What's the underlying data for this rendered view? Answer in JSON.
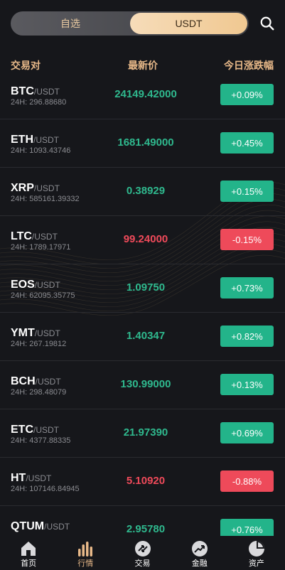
{
  "topbar": {
    "tab_fav": "自选",
    "tab_usdt": "USDT"
  },
  "header": {
    "pair": "交易对",
    "price": "最新价",
    "change": "今日涨跌幅"
  },
  "rows": [
    {
      "base": "BTC",
      "quote": "/USDT",
      "vol": "24H: 296.88680",
      "price": "24149.42000",
      "change": "+0.09%",
      "dir": "up"
    },
    {
      "base": "ETH",
      "quote": "/USDT",
      "vol": "24H: 1093.43746",
      "price": "1681.49000",
      "change": "+0.45%",
      "dir": "up"
    },
    {
      "base": "XRP",
      "quote": "/USDT",
      "vol": "24H: 585161.39332",
      "price": "0.38929",
      "change": "+0.15%",
      "dir": "up"
    },
    {
      "base": "LTC",
      "quote": "/USDT",
      "vol": "24H: 1789.17971",
      "price": "99.24000",
      "change": "-0.15%",
      "dir": "down"
    },
    {
      "base": "EOS",
      "quote": "/USDT",
      "vol": "24H: 62095.35775",
      "price": "1.09750",
      "change": "+0.73%",
      "dir": "up"
    },
    {
      "base": "YMT",
      "quote": "/USDT",
      "vol": "24H: 267.19812",
      "price": "1.40347",
      "change": "+0.82%",
      "dir": "up"
    },
    {
      "base": "BCH",
      "quote": "/USDT",
      "vol": "24H: 298.48079",
      "price": "130.99000",
      "change": "+0.13%",
      "dir": "up"
    },
    {
      "base": "ETC",
      "quote": "/USDT",
      "vol": "24H: 4377.88335",
      "price": "21.97390",
      "change": "+0.69%",
      "dir": "up"
    },
    {
      "base": "HT",
      "quote": "/USDT",
      "vol": "24H: 107146.84945",
      "price": "5.10920",
      "change": "-0.88%",
      "dir": "down"
    },
    {
      "base": "QTUM",
      "quote": "/USDT",
      "vol": "",
      "price": "2.95780",
      "change": "+0.76%",
      "dir": "up"
    }
  ],
  "tabbar": {
    "home": "首页",
    "market": "行情",
    "trade": "交易",
    "finance": "金融",
    "assets": "资产"
  },
  "colors": {
    "up": "#23b48a",
    "down": "#ee4a5a",
    "accent": "#e8b989"
  },
  "icons": [
    "search-icon",
    "home-icon",
    "market-icon",
    "trade-icon",
    "finance-icon",
    "assets-icon"
  ]
}
